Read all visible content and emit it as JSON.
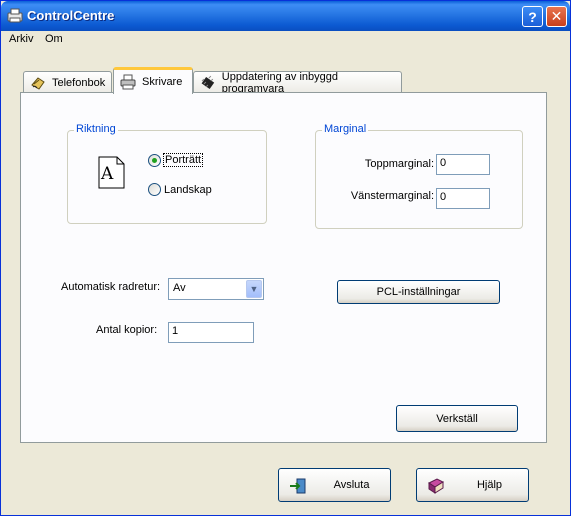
{
  "window": {
    "title": "ControlCentre",
    "icons": {
      "app": "controlcentre-app-icon",
      "help": "help-icon",
      "close": "close-icon"
    },
    "help_glyph": "?",
    "close_glyph": "✕"
  },
  "menu": {
    "items": [
      "Arkiv",
      "Om"
    ]
  },
  "tabs": [
    {
      "label": "Telefonbok",
      "icon": "phonebook-icon",
      "selected": false
    },
    {
      "label": "Skrivare",
      "icon": "printer-icon",
      "selected": true
    },
    {
      "label": "Uppdatering av inbyggd programvara",
      "icon": "firmware-chip-icon",
      "selected": false
    }
  ],
  "riktning": {
    "legend": "Riktning",
    "orientation_icon_letter": "A",
    "options": [
      {
        "label": "Porträtt",
        "checked": true
      },
      {
        "label": "Landskap",
        "checked": false
      }
    ]
  },
  "marginal": {
    "legend": "Marginal",
    "top_label": "Toppmarginal:",
    "top_value": "0",
    "left_label": "Vänstermarginal:",
    "left_value": "0"
  },
  "settings": {
    "auto_label": "Automatisk radretur:",
    "auto_value": "Av",
    "copies_label": "Antal kopior:",
    "copies_value": "1"
  },
  "buttons": {
    "pcl": "PCL-inställningar",
    "apply": "Verkställ",
    "exit": "Avsluta",
    "help": "Hjälp"
  },
  "colors": {
    "titlebar": "#0a5fd8",
    "legend_text": "#0046d5",
    "window_bg": "#ece9d8",
    "active_tab_accent": "#ffc83c"
  }
}
